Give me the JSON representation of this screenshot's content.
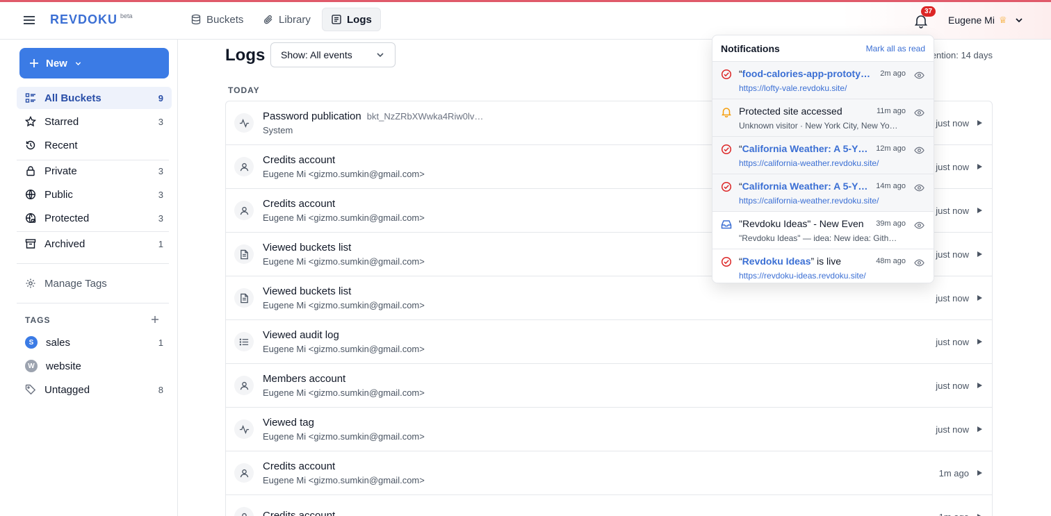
{
  "app": {
    "brand": "REVDOKU",
    "brand_tag": "beta",
    "nav_tabs": [
      {
        "label": "Buckets",
        "icon": "database-icon"
      },
      {
        "label": "Library",
        "icon": "paperclip-icon"
      },
      {
        "label": "Logs",
        "icon": "logs-icon",
        "active": true
      }
    ],
    "notification_count": "37",
    "user_name": "Eugene Mi",
    "user_badge": "crown-icon"
  },
  "sidebar": {
    "new_label": "New",
    "items": [
      {
        "label": "All Buckets",
        "count": "9",
        "icon": "grid-list-icon",
        "active": true
      },
      {
        "label": "Starred",
        "count": "3",
        "icon": "star-icon"
      },
      {
        "label": "Recent",
        "count": "",
        "icon": "history-icon"
      },
      {
        "label": "Private",
        "count": "3",
        "icon": "lock-icon"
      },
      {
        "label": "Public",
        "count": "3",
        "icon": "globe-icon"
      },
      {
        "label": "Protected",
        "count": "3",
        "icon": "globe-lock-icon"
      },
      {
        "label": "Archived",
        "count": "1",
        "icon": "archive-icon"
      }
    ],
    "manage_tags": "Manage Tags",
    "tags_heading": "TAGS",
    "tags": [
      {
        "label": "sales",
        "count": "1",
        "letter": "S",
        "color": "#3b7be5"
      },
      {
        "label": "website",
        "count": "",
        "letter": "W",
        "color": "#9ca3af"
      },
      {
        "label": "Untagged",
        "count": "8",
        "letter": "",
        "color": ""
      }
    ]
  },
  "main": {
    "title": "Logs",
    "filter_label": "Show: All events",
    "retention_text": "ention: 14 days",
    "section_label": "TODAY",
    "rows": [
      {
        "title": "Password publication",
        "id": "bkt_NzZRbXWwka4Riw0lv…",
        "subtitle": "System",
        "time": "just now",
        "icon": "activity-icon"
      },
      {
        "title": "Credits account",
        "id": "",
        "subtitle": "Eugene Mi <gizmo.sumkin@gmail.com>",
        "time": "just now",
        "icon": "user-icon"
      },
      {
        "title": "Credits account",
        "id": "",
        "subtitle": "Eugene Mi <gizmo.sumkin@gmail.com>",
        "time": "just now",
        "icon": "user-icon"
      },
      {
        "title": "Viewed buckets list",
        "id": "",
        "subtitle": "Eugene Mi <gizmo.sumkin@gmail.com>",
        "time": "just now",
        "icon": "document-icon"
      },
      {
        "title": "Viewed buckets list",
        "id": "",
        "subtitle": "Eugene Mi <gizmo.sumkin@gmail.com>",
        "time": "just now",
        "icon": "document-icon"
      },
      {
        "title": "Viewed audit log",
        "id": "",
        "subtitle": "Eugene Mi <gizmo.sumkin@gmail.com>",
        "time": "just now",
        "icon": "list-icon"
      },
      {
        "title": "Members account",
        "id": "",
        "subtitle": "Eugene Mi <gizmo.sumkin@gmail.com>",
        "time": "just now",
        "icon": "user-icon"
      },
      {
        "title": "Viewed tag",
        "id": "",
        "subtitle": "Eugene Mi <gizmo.sumkin@gmail.com>",
        "time": "just now",
        "icon": "activity-icon"
      },
      {
        "title": "Credits account",
        "id": "",
        "subtitle": "Eugene Mi <gizmo.sumkin@gmail.com>",
        "time": "1m ago",
        "icon": "user-icon"
      },
      {
        "title": "Credits account",
        "id": "",
        "subtitle": "",
        "time": "1m ago",
        "icon": "user-icon"
      }
    ]
  },
  "notifications": {
    "title": "Notifications",
    "mark_all": "Mark all as read",
    "items": [
      {
        "prefix": "“",
        "link": "food-calories-app-prototy…",
        "suffix": "",
        "time": "2m ago",
        "sub": "https://lofty-vale.revdoku.site/",
        "sub_is_url": true,
        "icon": "check-circle-icon",
        "unread": true
      },
      {
        "prefix": "Protected site accessed",
        "link": "",
        "suffix": "",
        "time": "11m ago",
        "sub": "Unknown visitor · New York City, New Yo…",
        "sub_is_url": false,
        "icon": "bell-icon",
        "unread": true
      },
      {
        "prefix": "“",
        "link": "California Weather: A 5-Y…",
        "suffix": "",
        "time": "12m ago",
        "sub": "https://california-weather.revdoku.site/",
        "sub_is_url": true,
        "icon": "check-circle-icon",
        "unread": true
      },
      {
        "prefix": "“",
        "link": "California Weather: A 5-Y…",
        "suffix": "",
        "time": "14m ago",
        "sub": "https://california-weather.revdoku.site/",
        "sub_is_url": true,
        "icon": "check-circle-icon",
        "unread": true
      },
      {
        "prefix": "\"Revdoku Ideas\" - New Even",
        "link": "",
        "suffix": "",
        "time": "39m ago",
        "sub": "\"Revdoku Ideas\" — idea: New idea: Gith…",
        "sub_is_url": false,
        "icon": "inbox-icon",
        "unread": false
      },
      {
        "prefix": "“",
        "link": "Revdoku Ideas",
        "suffix": "” is live",
        "time": "48m ago",
        "sub": "https://revdoku-ideas.revdoku.site/",
        "sub_is_url": true,
        "icon": "check-circle-icon",
        "unread": false
      }
    ]
  },
  "colors": {
    "accent": "#3b7be5",
    "link": "#3b6fd4",
    "success_icon": "#dc2626",
    "warning_icon": "#f59e0b"
  }
}
